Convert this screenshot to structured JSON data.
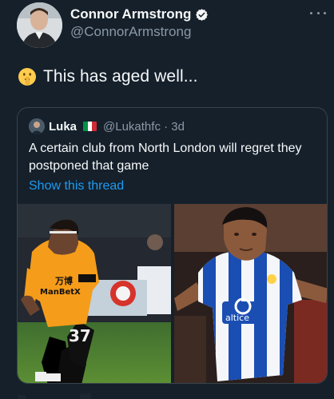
{
  "author": {
    "name": "Connor Armstrong",
    "handle": "@ConnorArmstrong"
  },
  "tweet": {
    "text": "This has aged well...",
    "emoji": "shushing-face-emoji"
  },
  "quoted": {
    "name": "Luka",
    "flag": "italy-flag",
    "handle_time": "@Lukathfc · 3d",
    "text": "A certain club from North London will regret they postponed that game",
    "show_thread": "Show this thread",
    "photo_left": {
      "shirt_badge": "万博",
      "shirt_sponsor": "ManBetX",
      "shorts_number": "37"
    },
    "photo_right": {
      "shirt_sponsor": "altice"
    }
  },
  "colors": {
    "background": "#15202b",
    "accent": "#1d9bf0",
    "secondary_text": "#8b98a5",
    "border": "#38444d"
  }
}
